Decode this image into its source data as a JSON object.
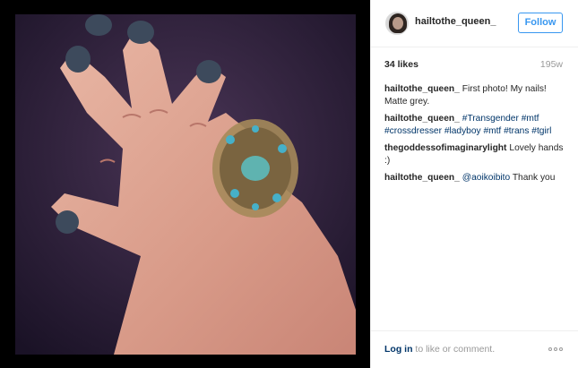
{
  "post": {
    "username": "hailtothe_queen_",
    "follow_label": "Follow",
    "likes": "34 likes",
    "age": "195w"
  },
  "comments": [
    {
      "author": "hailtothe_queen_",
      "segments": [
        {
          "text": "First photo! My nails! Matte grey.",
          "tag": false
        }
      ]
    },
    {
      "author": "hailtothe_queen_",
      "segments": [
        {
          "text": "#Transgender",
          "tag": true
        },
        {
          "text": " ",
          "tag": false
        },
        {
          "text": "#mtf",
          "tag": true
        },
        {
          "text": " ",
          "tag": false
        },
        {
          "text": "#crossdresser",
          "tag": true
        },
        {
          "text": " ",
          "tag": false
        },
        {
          "text": "#ladyboy",
          "tag": true
        },
        {
          "text": " ",
          "tag": false
        },
        {
          "text": "#mtf",
          "tag": true
        },
        {
          "text": " ",
          "tag": false
        },
        {
          "text": "#trans",
          "tag": true
        },
        {
          "text": " ",
          "tag": false
        },
        {
          "text": "#tgirl",
          "tag": true
        }
      ]
    },
    {
      "author": "thegoddessofimaginarylight",
      "segments": [
        {
          "text": "Lovely hands :)",
          "tag": false
        }
      ]
    },
    {
      "author": "hailtothe_queen_",
      "segments": [
        {
          "text": "@aoikoibito",
          "tag": true
        },
        {
          "text": " Thank you",
          "tag": false
        }
      ]
    }
  ],
  "footer": {
    "login_link": "Log in",
    "login_rest": " to like or comment.",
    "more_icon": "more-options-icon"
  },
  "colors": {
    "link": "#003569",
    "follow": "#3897f0",
    "muted": "#999999"
  }
}
